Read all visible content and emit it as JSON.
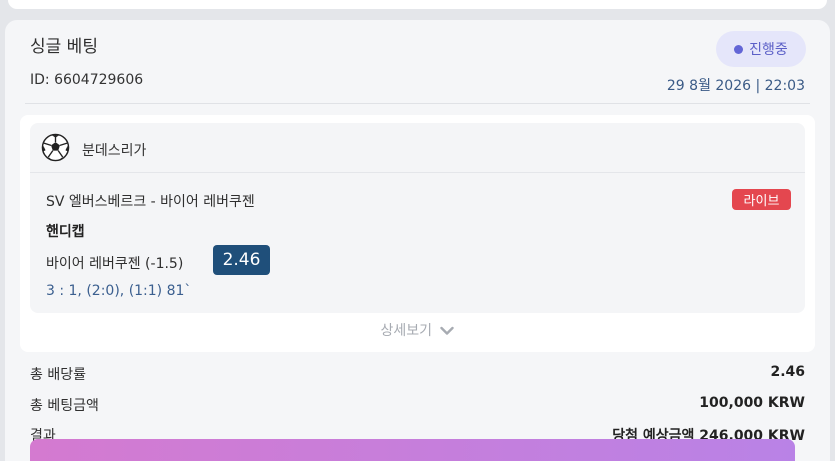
{
  "bet": {
    "title": "싱글 베팅",
    "status": "진행중",
    "id_text": "ID: 6604729606",
    "date_text": "29 8월 2026 | 22:03"
  },
  "match": {
    "league": "분데스리가",
    "name": "SV 엘버스베르크 - 바이어 레버쿠젠",
    "live_label": "라이브",
    "market": "핸디캡",
    "selection": "바이어 레버쿠젠 (-1.5)",
    "odds": "2.46",
    "score": "3 : 1, (2:0), (1:1) 81`"
  },
  "detail_toggle": "상세보기",
  "summary": {
    "total_odds_label": "총 배당률",
    "total_odds_value": "2.46",
    "total_stake_label": "총 베팅금액",
    "total_stake_value": "100,000 KRW",
    "result_label": "결과",
    "result_value": "당첨 예상금액 246,000 KRW"
  },
  "colors": {
    "status_accent": "#5b5fc7",
    "live_badge": "#e4474f",
    "odds_badge": "#1f4f7a",
    "score_text": "#3b5f8f"
  },
  "icons": {
    "sport": "soccer-ball-icon",
    "toggle": "chevron-down-icon"
  }
}
